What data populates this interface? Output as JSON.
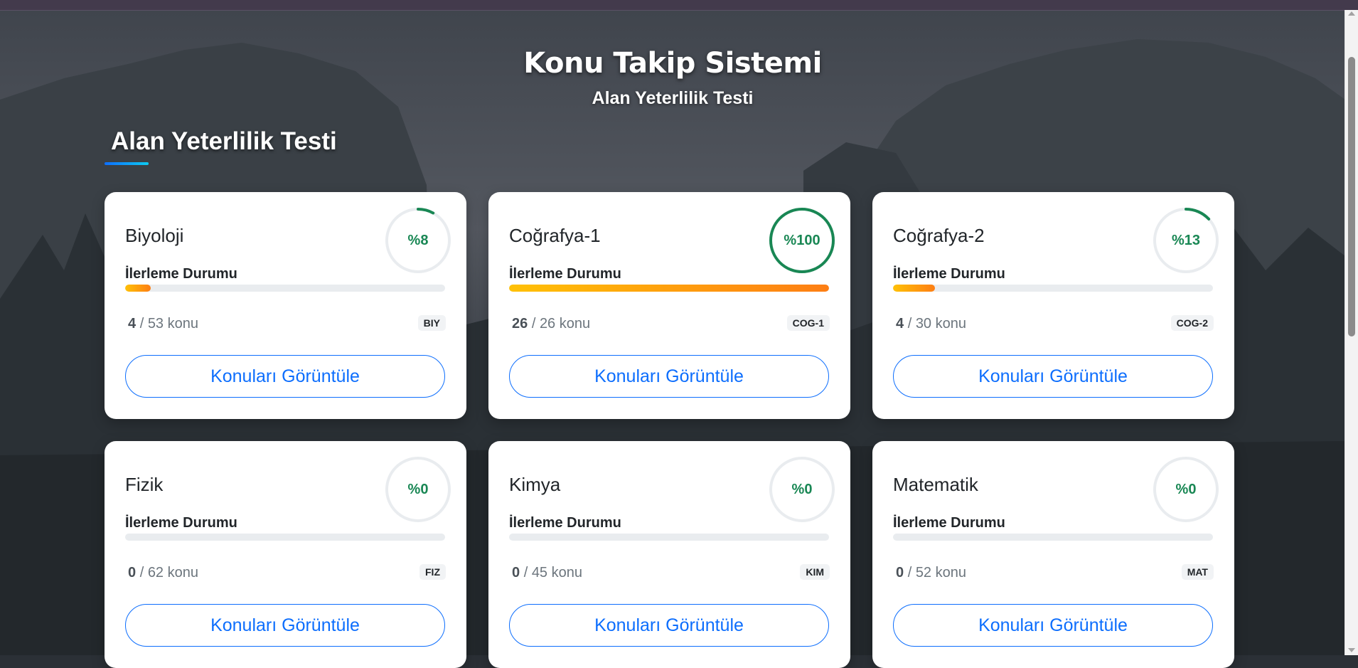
{
  "header": {
    "title": "Konu Takip Sistemi",
    "subtitle": "Alan Yeterlilik Testi"
  },
  "section": {
    "title": "Alan Yeterlilik Testi"
  },
  "labels": {
    "progress": "İlerleme Durumu",
    "button": "Konuları Görüntüle",
    "separator": "/",
    "unit": "konu"
  },
  "colors": {
    "ring": "#198754",
    "progress_start": "#ffc107",
    "progress_end": "#fd7e14",
    "button": "#0d6efd"
  },
  "cards": [
    {
      "name": "Biyoloji",
      "percent_label": "%8",
      "progress": 0.08,
      "done": "4",
      "total": "53",
      "code": "BIY"
    },
    {
      "name": "Coğrafya-1",
      "percent_label": "%100",
      "progress": 1.0,
      "done": "26",
      "total": "26",
      "code": "COG-1"
    },
    {
      "name": "Coğrafya-2",
      "percent_label": "%13",
      "progress": 0.13,
      "done": "4",
      "total": "30",
      "code": "COG-2"
    },
    {
      "name": "Fizik",
      "percent_label": "%0",
      "progress": 0,
      "done": "0",
      "total": "62",
      "code": "FIZ"
    },
    {
      "name": "Kimya",
      "percent_label": "%0",
      "progress": 0,
      "done": "0",
      "total": "45",
      "code": "KIM"
    },
    {
      "name": "Matematik",
      "percent_label": "%0",
      "progress": 0,
      "done": "0",
      "total": "52",
      "code": "MAT"
    }
  ]
}
